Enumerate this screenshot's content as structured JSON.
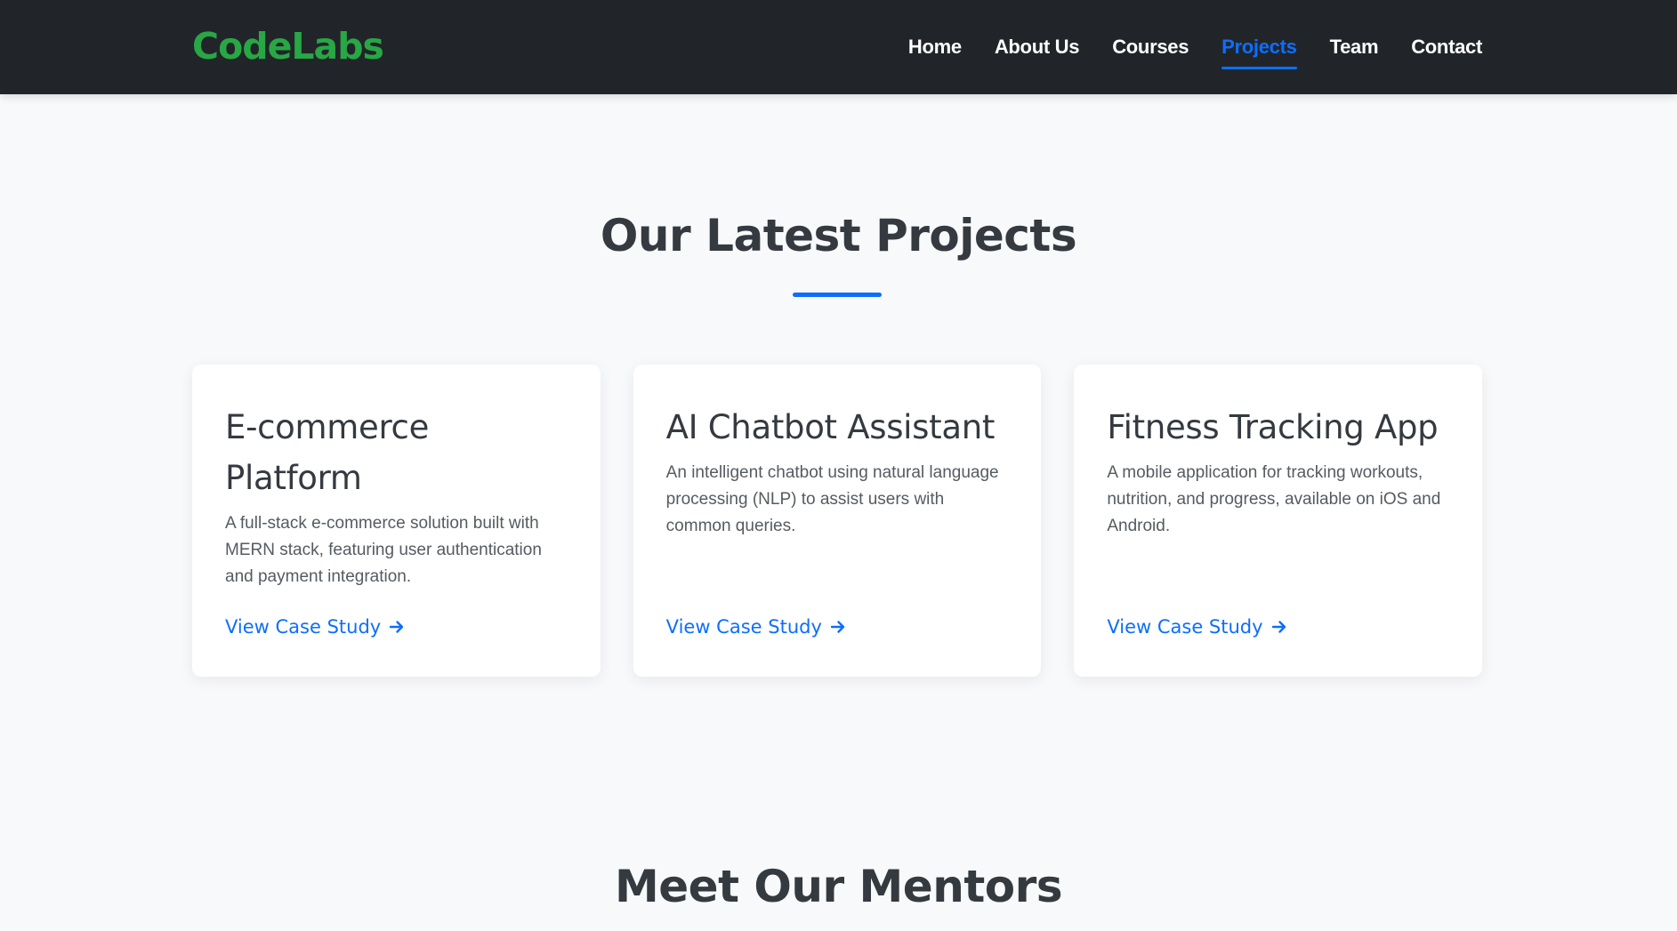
{
  "brand": {
    "name": "CodeLabs",
    "color": "#28a745"
  },
  "nav": {
    "items": [
      {
        "label": "Home",
        "active": false
      },
      {
        "label": "About Us",
        "active": false
      },
      {
        "label": "Courses",
        "active": false
      },
      {
        "label": "Projects",
        "active": true
      },
      {
        "label": "Team",
        "active": false
      },
      {
        "label": "Contact",
        "active": false
      }
    ]
  },
  "projects": {
    "title": "Our Latest Projects",
    "cards": [
      {
        "title": "E-commerce Platform",
        "description": "A full-stack e-commerce solution built with MERN stack, featuring user authentication and payment integration.",
        "link_label": "View Case Study",
        "link_icon": "arrow-right-icon"
      },
      {
        "title": "AI Chatbot Assistant",
        "description": "An intelligent chatbot using natural language processing (NLP) to assist users with common queries.",
        "link_label": "View Case Study",
        "link_icon": "arrow-right-icon"
      },
      {
        "title": "Fitness Tracking App",
        "description": "A mobile application for tracking workouts, nutrition, and progress, available on iOS and Android.",
        "link_label": "View Case Study",
        "link_icon": "arrow-right-icon"
      }
    ]
  },
  "mentors": {
    "title": "Meet Our Mentors"
  },
  "colors": {
    "navbar_bg": "#212529",
    "accent": "#0d6efd",
    "page_bg": "#f8f9fa",
    "heading": "#343a40"
  }
}
